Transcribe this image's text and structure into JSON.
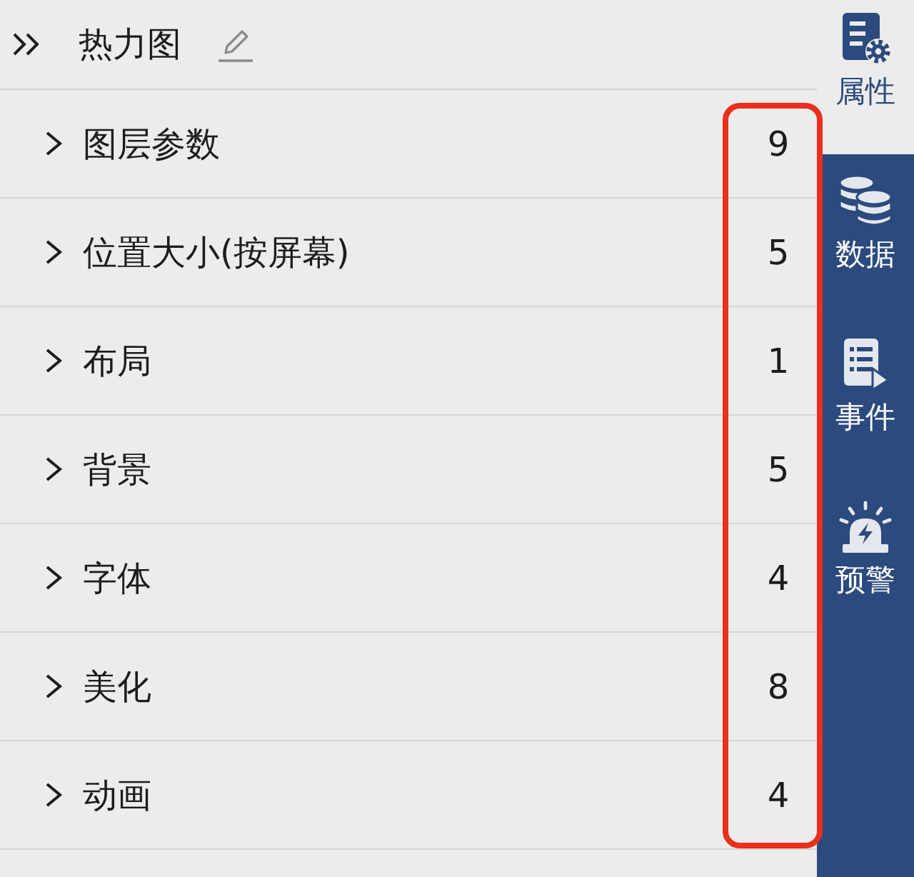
{
  "header": {
    "title": "热力图"
  },
  "sections": [
    {
      "label": "图层参数",
      "count": "9",
      "expanded": false
    },
    {
      "label": "位置大小(按屏幕)",
      "count": "5",
      "expanded": false
    },
    {
      "label": "布局",
      "count": "1",
      "expanded": false
    },
    {
      "label": "背景",
      "count": "5",
      "expanded": false
    },
    {
      "label": "字体",
      "count": "4",
      "expanded": false
    },
    {
      "label": "美化",
      "count": "8",
      "expanded": false
    },
    {
      "label": "动画",
      "count": "4",
      "expanded": false
    }
  ],
  "sidebar": {
    "items": [
      {
        "label": "属性",
        "kind": "properties",
        "selected": true
      },
      {
        "label": "数据",
        "kind": "data",
        "selected": false
      },
      {
        "label": "事件",
        "kind": "events",
        "selected": false
      },
      {
        "label": "预警",
        "kind": "alerts",
        "selected": false
      }
    ]
  }
}
